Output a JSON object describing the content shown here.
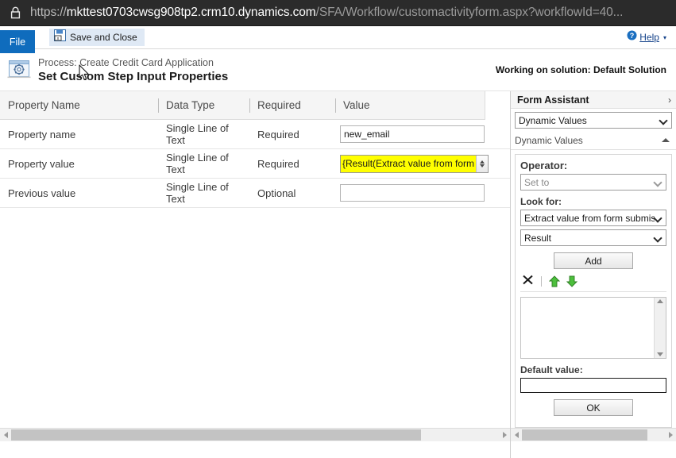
{
  "browser": {
    "lock_icon": "lock-icon",
    "url_scheme": "https://",
    "url_host": "mkttest0703cwsg908tp2.crm10.dynamics.com",
    "url_path": "/SFA/Workflow/customactivityform.aspx?workflowId=40..."
  },
  "ribbon": {
    "file_tab": "File",
    "save_and_close": "Save and Close",
    "save_icon": "save-and-close-icon",
    "help_label": "Help",
    "help_icon": "help-question-icon",
    "help_caret": "▾"
  },
  "title_band": {
    "process_icon": "process-step-icon",
    "process_line": "Process: Create Credit Card Application",
    "step_title": "Set Custom Step Input Properties",
    "solution_note": "Working on solution: Default Solution"
  },
  "grid": {
    "columns": [
      "Property Name",
      "Data Type",
      "Required",
      "Value"
    ],
    "rows": [
      {
        "property_name": "Property name",
        "data_type": "Single Line of Text",
        "required": "Required",
        "value": "new_email",
        "value_kind": "input",
        "highlighted": false
      },
      {
        "property_name": "Property value",
        "data_type": "Single Line of Text",
        "required": "Required",
        "value": "{Result(Extract value from form",
        "value_kind": "combo",
        "highlighted": true
      },
      {
        "property_name": "Previous value",
        "data_type": "Single Line of Text",
        "required": "Optional",
        "value": "",
        "value_kind": "input",
        "highlighted": false
      }
    ]
  },
  "form_assistant": {
    "header_title": "Form Assistant",
    "collapse_icon": "chevron-right-icon",
    "source_select": "Dynamic Values",
    "section_title": "Dynamic Values",
    "section_caret_icon": "chevron-up-icon",
    "operator_label": "Operator:",
    "operator_value": "Set to",
    "look_for_label": "Look for:",
    "look_for_value": "Extract value from form submission",
    "look_for_field": "Result",
    "add_button": "Add",
    "delete_icon": "delete-x-icon",
    "move_up_icon": "arrow-up-green-icon",
    "move_down_icon": "arrow-down-green-icon",
    "list_scroll_up_icon": "scroll-up-icon",
    "list_scroll_down_icon": "scroll-down-icon",
    "default_value_label": "Default value:",
    "default_value": "",
    "ok_button": "OK"
  },
  "scrollbars": {
    "left_arrow_icon": "scroll-left-icon",
    "right_arrow_icon": "scroll-right-icon"
  },
  "colors": {
    "accent": "#0f6cbd",
    "highlight": "#ffff00",
    "urlbar_bg": "#2b2b2b",
    "header_bg": "#f5f5f5"
  }
}
